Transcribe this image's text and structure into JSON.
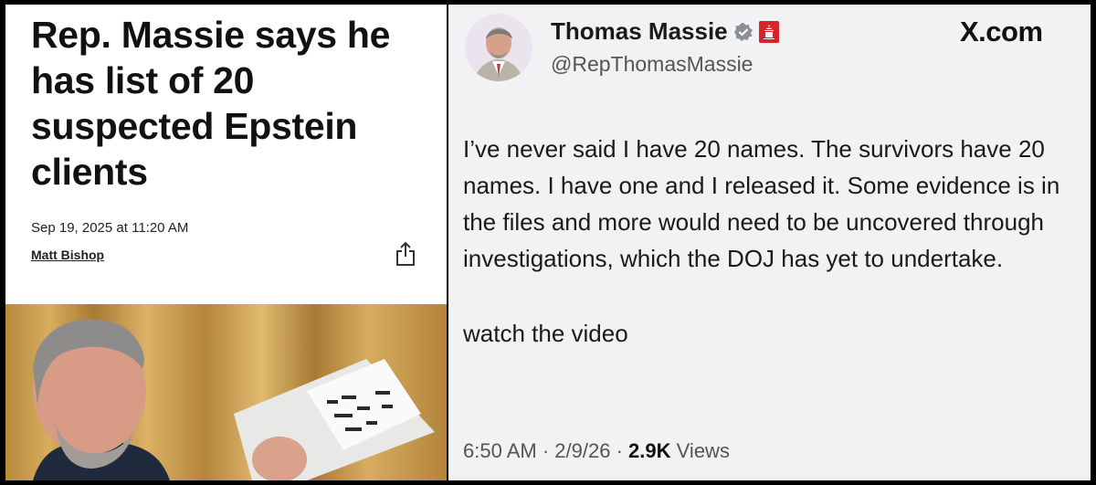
{
  "article": {
    "headline": "Rep. Massie says he has list of 20 suspected Epstein clients",
    "date": "Sep 19, 2025 at 11:20 AM",
    "author": "Matt Bishop",
    "share_icon": "share-icon"
  },
  "tweet": {
    "display_name": "Thomas Massie",
    "handle": "@RepThomasMassie",
    "site_label": "X.com",
    "verified_icon": "verified-badge-icon",
    "affiliation_icon": "capitol-flag-icon",
    "body": "I’ve never said I have 20 names. The survivors have 20 names. I have one and I released it. Some evidence is in the files and more would need to be uncovered through investigations, which the DOJ has yet to undertake.",
    "link_text": "watch the video",
    "time": "6:50 AM",
    "date": "2/9/26",
    "views_count": "2.9K",
    "views_label": "Views",
    "separator": "·"
  },
  "colors": {
    "verified_badge": "#8a8f99",
    "flag_red": "#d6242b",
    "background_left": "#ffffff",
    "background_right": "#f2f2f4"
  }
}
